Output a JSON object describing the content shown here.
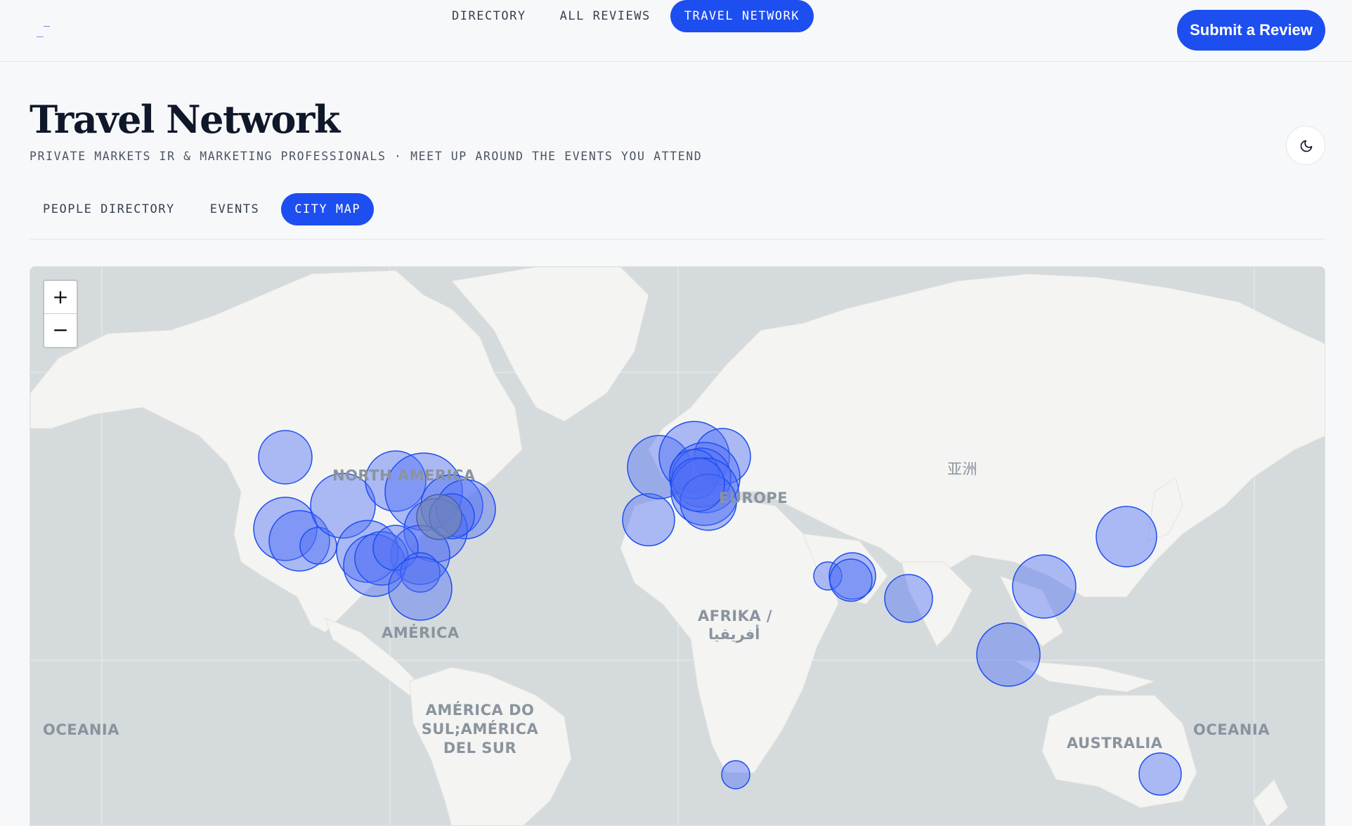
{
  "header": {
    "logo": "_‾",
    "nav": [
      {
        "label": "DIRECTORY",
        "active": false
      },
      {
        "label": "ALL REVIEWS",
        "active": false
      },
      {
        "label": "TRAVEL NETWORK",
        "active": true
      }
    ],
    "cta": "Submit a Review"
  },
  "page": {
    "title": "Travel Network",
    "subtitle": "PRIVATE MARKETS IR & MARKETING PROFESSIONALS · MEET UP AROUND THE EVENTS YOU ATTEND",
    "theme_toggle_icon": "moon-icon"
  },
  "tabs": [
    {
      "label": "PEOPLE DIRECTORY",
      "active": false
    },
    {
      "label": "EVENTS",
      "active": false
    },
    {
      "label": "CITY MAP",
      "active": true
    }
  ],
  "map": {
    "zoom_in": "+",
    "zoom_out": "−",
    "labels": {
      "north_america": "NORTH AMERICA",
      "america": "AMÉRICA",
      "south_america": "AMÉRICA DO SUL;AMÉRICA DEL SUR",
      "africa_1": "AFRIKA /",
      "africa_2": "أفريقيا",
      "asia": "亚洲",
      "europe": "EUROPE",
      "australia": "AUSTRALIA",
      "oceania_left": "OCEANIA",
      "oceania_right": "OCEANIA"
    },
    "colors": {
      "marker_fill": "#4f6ef7",
      "marker_stroke": "#1d4ef0",
      "ocean": "#d5dadc",
      "land": "#f4f4f2"
    }
  }
}
